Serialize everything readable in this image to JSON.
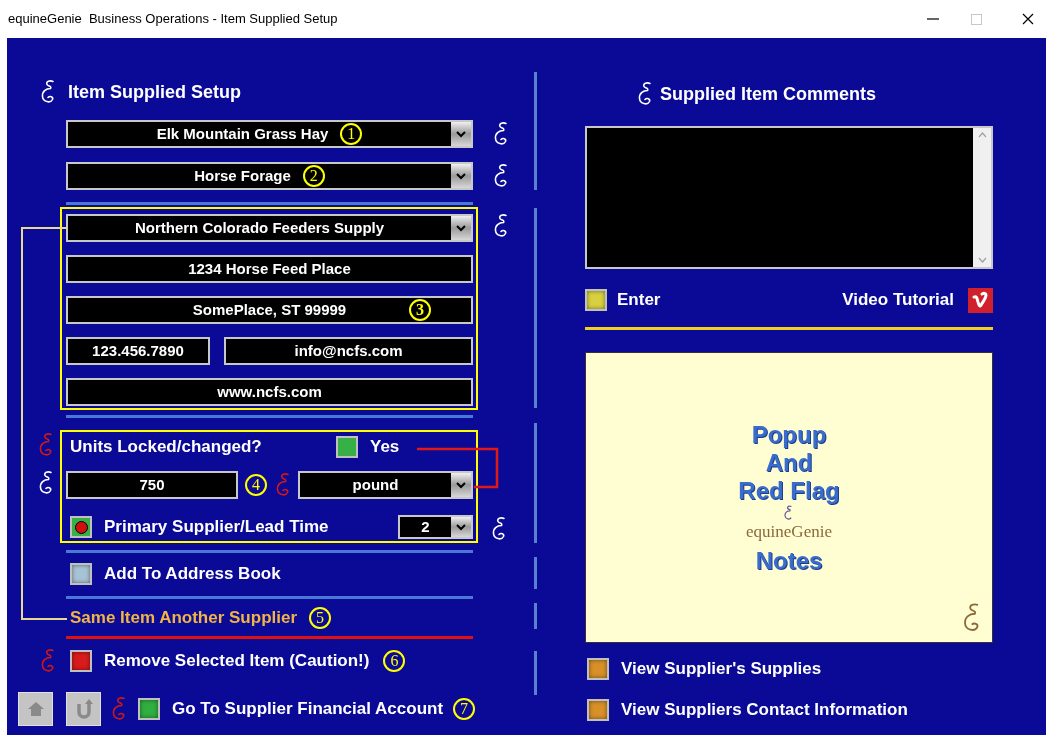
{
  "window": {
    "title": "equineGenie  Business Operations - Item Supplied Setup"
  },
  "item_setup": {
    "heading": "Item Supplied Setup",
    "item": {
      "value": "Elk Mountain Grass Hay",
      "callout": "1"
    },
    "category": {
      "value": "Horse Forage",
      "callout": "2"
    }
  },
  "supplier": {
    "callout": "3",
    "name": "Northern Colorado Feeders Supply",
    "address": "1234 Horse Feed Place",
    "city": "SomePlace, ST 99999",
    "phone": "123.456.7890",
    "email": "info@ncfs.com",
    "web": "www.ncfs.com"
  },
  "units": {
    "label": "Units Locked/changed?",
    "locked": {
      "checked": true,
      "label": "Yes"
    },
    "quantity": "750",
    "callout": "4",
    "unit": "pound",
    "primary": {
      "checked": true,
      "label": "Primary Supplier/Lead Time"
    },
    "lead_time": "2"
  },
  "add_to_address_book": {
    "label": "Add To Address Book",
    "color": "#a8c4d4"
  },
  "same_item_link": {
    "label": "Same Item Another Supplier",
    "callout": "5"
  },
  "remove_item": {
    "label": "Remove Selected Item (Caution!)",
    "color": "#d81c1c",
    "callout": "6"
  },
  "financial_account": {
    "label": "Go To Supplier Financial Account",
    "color": "#30b040",
    "callout": "7"
  },
  "comments": {
    "heading": "Supplied Item Comments",
    "enter": {
      "label": "Enter",
      "color": "#d8d040"
    },
    "video_tutorial": "Video Tutorial"
  },
  "notes_panel": {
    "lines": [
      "Popup",
      "And",
      "Red Flag"
    ],
    "logo": "equineGenie",
    "footer": "Notes"
  },
  "right_actions": [
    {
      "label": "View Supplier's Supplies",
      "color": "#d89028"
    },
    {
      "label": "View Suppliers Contact Information",
      "color": "#d89028"
    }
  ]
}
